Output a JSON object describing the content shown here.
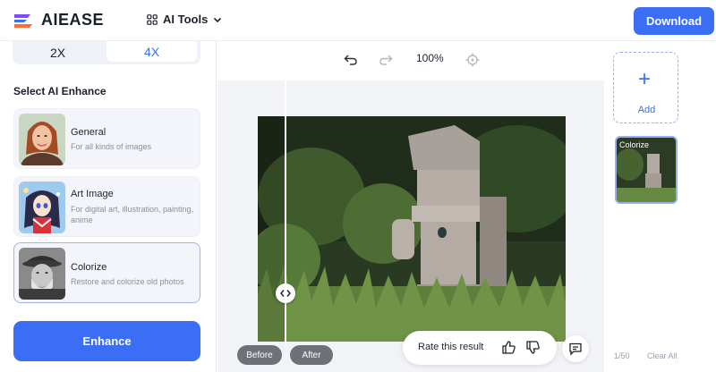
{
  "header": {
    "logo_text": "AIEASE",
    "tools_label": "AI Tools",
    "download_label": "Download"
  },
  "scale": {
    "options": [
      "2X",
      "4X"
    ],
    "selected": "4X"
  },
  "enhance": {
    "section_title": "Select AI Enhance",
    "cards": [
      {
        "title": "General",
        "desc": "For all kinds of images"
      },
      {
        "title": "Art Image",
        "desc": "For digital art, illustration, painting, anime"
      },
      {
        "title": "Colorize",
        "desc": "Restore and colorize old photos"
      }
    ],
    "selected": "Colorize",
    "button_label": "Enhance"
  },
  "toolbar": {
    "zoom": "100%",
    "icons": [
      "undo-icon",
      "redo-icon",
      "target-icon"
    ]
  },
  "compare": {
    "before_label": "Before",
    "after_label": "After"
  },
  "rating": {
    "text": "Rate this result",
    "icons": [
      "thumbs-up-icon",
      "thumbs-down-icon",
      "feedback-icon"
    ]
  },
  "right_panel": {
    "add_label": "Add",
    "thumb_label": "Colorize",
    "count": "1/50",
    "clear_label": "Clear All"
  },
  "colors": {
    "accent": "#3b6ef5",
    "pill": "#6f7179"
  }
}
